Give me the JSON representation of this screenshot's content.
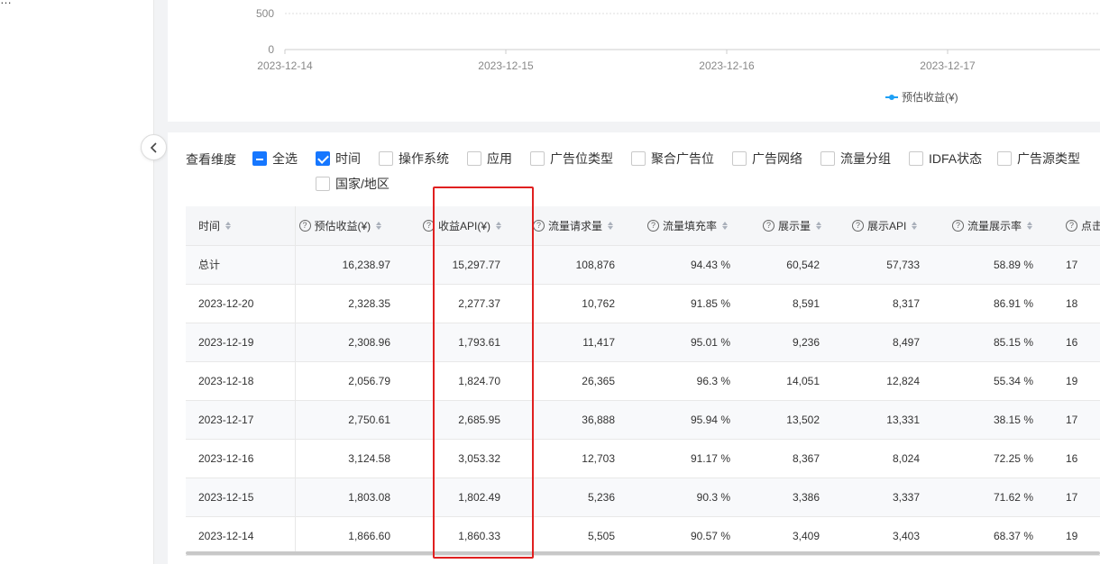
{
  "sidebar": {
    "cut_text": "…"
  },
  "chart_data": {
    "type": "line",
    "x": [
      "2023-12-14",
      "2023-12-15",
      "2023-12-16",
      "2023-12-17"
    ],
    "ytick_labels": [
      "500",
      "0"
    ],
    "series": [
      {
        "name": "预估收益(¥)",
        "color": "#1ea0f5"
      }
    ]
  },
  "dimensions": {
    "label": "查看维度",
    "options": [
      {
        "label": "全选",
        "state": "indeterminate"
      },
      {
        "label": "时间",
        "state": "checked"
      },
      {
        "label": "操作系统",
        "state": "unchecked"
      },
      {
        "label": "应用",
        "state": "unchecked"
      },
      {
        "label": "广告位类型",
        "state": "unchecked"
      },
      {
        "label": "聚合广告位",
        "state": "unchecked"
      },
      {
        "label": "广告网络",
        "state": "unchecked"
      },
      {
        "label": "流量分组",
        "state": "unchecked"
      },
      {
        "label": "IDFA状态",
        "state": "unchecked"
      },
      {
        "label": "广告源类型",
        "state": "unchecked"
      },
      {
        "label": "国家/地区",
        "state": "unchecked"
      }
    ]
  },
  "table": {
    "columns": [
      "时间",
      "预估收益(¥)",
      "收益API(¥)",
      "流量请求量",
      "流量填充率",
      "展示量",
      "展示API",
      "流量展示率",
      "点击"
    ],
    "rows": [
      [
        "总计",
        "16,238.97",
        "15,297.77",
        "108,876",
        "94.43 %",
        "60,542",
        "57,733",
        "58.89 %",
        "17"
      ],
      [
        "2023-12-20",
        "2,328.35",
        "2,277.37",
        "10,762",
        "91.85 %",
        "8,591",
        "8,317",
        "86.91 %",
        "18"
      ],
      [
        "2023-12-19",
        "2,308.96",
        "1,793.61",
        "11,417",
        "95.01 %",
        "9,236",
        "8,497",
        "85.15 %",
        "16"
      ],
      [
        "2023-12-18",
        "2,056.79",
        "1,824.70",
        "26,365",
        "96.3 %",
        "14,051",
        "12,824",
        "55.34 %",
        "19"
      ],
      [
        "2023-12-17",
        "2,750.61",
        "2,685.95",
        "36,888",
        "95.94 %",
        "13,502",
        "13,331",
        "38.15 %",
        "17"
      ],
      [
        "2023-12-16",
        "3,124.58",
        "3,053.32",
        "12,703",
        "91.17 %",
        "8,367",
        "8,024",
        "72.25 %",
        "16"
      ],
      [
        "2023-12-15",
        "1,803.08",
        "1,802.49",
        "5,236",
        "90.3 %",
        "3,386",
        "3,337",
        "71.62 %",
        "17"
      ],
      [
        "2023-12-14",
        "1,866.60",
        "1,860.33",
        "5,505",
        "90.57 %",
        "3,409",
        "3,403",
        "68.37 %",
        "19"
      ]
    ]
  }
}
